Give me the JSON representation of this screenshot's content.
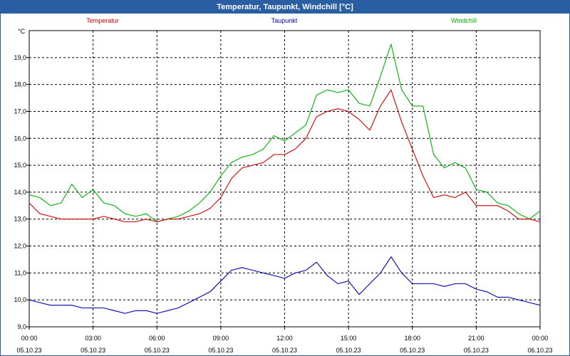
{
  "window": {
    "title": "Temperatur, Taupunkt, Windchill [°C]"
  },
  "chart_data": {
    "type": "line",
    "title": "Temperatur, Taupunkt, Windchill [°C]",
    "ylabel": "°C",
    "xlabel": "",
    "ylim": [
      9.0,
      20.0
    ],
    "y_ticks": [
      "9,0",
      "10,0",
      "11,0",
      "12,0",
      "13,0",
      "14,0",
      "15,0",
      "16,0",
      "17,0",
      "18,0",
      "19,0"
    ],
    "xlim": [
      0,
      24
    ],
    "x_ticks": [
      {
        "time": "00:00",
        "date": "05.10.23"
      },
      {
        "time": "03:00",
        "date": "05.10.23"
      },
      {
        "time": "06:00",
        "date": "05.10.23"
      },
      {
        "time": "09:00",
        "date": "05.10.23"
      },
      {
        "time": "12:00",
        "date": "05.10.23"
      },
      {
        "time": "15:00",
        "date": "05.10.23"
      },
      {
        "time": "18:00",
        "date": "05.10.23"
      },
      {
        "time": "21:00",
        "date": "05.10.23"
      },
      {
        "time": "00:00",
        "date": "06.10.23"
      }
    ],
    "grid": true,
    "legend": "top",
    "series": [
      {
        "name": "Temperatur",
        "color": "#d00000",
        "x": [
          0,
          0.5,
          1,
          1.5,
          2,
          2.5,
          3,
          3.5,
          4,
          4.5,
          5,
          5.5,
          6,
          6.5,
          7,
          7.5,
          8,
          8.5,
          9,
          9.5,
          10,
          10.5,
          11,
          11.5,
          12,
          12.5,
          13,
          13.5,
          14,
          14.5,
          15,
          15.5,
          16,
          16.5,
          17,
          17.5,
          18,
          18.5,
          19,
          19.5,
          20,
          20.5,
          21,
          21.5,
          22,
          22.5,
          23,
          23.5,
          24
        ],
        "values": [
          13.6,
          13.2,
          13.1,
          13.0,
          13.0,
          13.0,
          13.0,
          13.1,
          13.0,
          12.9,
          12.9,
          13.0,
          12.9,
          13.0,
          13.0,
          13.1,
          13.2,
          13.4,
          13.8,
          14.5,
          14.9,
          15.0,
          15.1,
          15.4,
          15.4,
          15.6,
          16.0,
          16.8,
          17.0,
          17.1,
          17.0,
          16.7,
          16.3,
          17.2,
          17.8,
          16.6,
          15.6,
          14.6,
          13.8,
          13.9,
          13.8,
          14.0,
          13.5,
          13.5,
          13.5,
          13.3,
          13.0,
          13.0,
          12.9
        ]
      },
      {
        "name": "Taupunkt",
        "color": "#0000b0",
        "x": [
          0,
          0.5,
          1,
          1.5,
          2,
          2.5,
          3,
          3.5,
          4,
          4.5,
          5,
          5.5,
          6,
          6.5,
          7,
          7.5,
          8,
          8.5,
          9,
          9.5,
          10,
          10.5,
          11,
          11.5,
          12,
          12.5,
          13,
          13.5,
          14,
          14.5,
          15,
          15.5,
          16,
          16.5,
          17,
          17.5,
          18,
          18.5,
          19,
          19.5,
          20,
          20.5,
          21,
          21.5,
          22,
          22.5,
          23,
          23.5,
          24
        ],
        "values": [
          10.0,
          9.9,
          9.8,
          9.8,
          9.8,
          9.7,
          9.7,
          9.7,
          9.6,
          9.5,
          9.6,
          9.6,
          9.5,
          9.6,
          9.7,
          9.9,
          10.1,
          10.3,
          10.7,
          11.1,
          11.2,
          11.1,
          11.0,
          10.9,
          10.8,
          11.0,
          11.1,
          11.4,
          10.9,
          10.6,
          10.7,
          10.2,
          10.6,
          11.0,
          11.6,
          11.0,
          10.6,
          10.6,
          10.6,
          10.5,
          10.6,
          10.6,
          10.4,
          10.3,
          10.1,
          10.1,
          10.0,
          9.9,
          9.8
        ]
      },
      {
        "name": "Windchill",
        "color": "#00b000",
        "x": [
          0,
          0.5,
          1,
          1.5,
          2,
          2.5,
          3,
          3.5,
          4,
          4.5,
          5,
          5.5,
          6,
          6.5,
          7,
          7.5,
          8,
          8.5,
          9,
          9.5,
          10,
          10.5,
          11,
          11.5,
          12,
          12.5,
          13,
          13.5,
          14,
          14.5,
          15,
          15.5,
          16,
          16.5,
          17,
          17.5,
          18,
          18.5,
          19,
          19.5,
          20,
          20.5,
          21,
          21.5,
          22,
          22.5,
          23,
          23.5,
          24
        ],
        "values": [
          13.9,
          13.8,
          13.5,
          13.6,
          14.3,
          13.8,
          14.1,
          13.6,
          13.5,
          13.2,
          13.1,
          13.2,
          12.9,
          13.0,
          13.1,
          13.3,
          13.6,
          14.0,
          14.6,
          15.1,
          15.3,
          15.4,
          15.6,
          16.1,
          15.9,
          16.2,
          16.5,
          17.6,
          17.8,
          17.7,
          17.8,
          17.3,
          17.2,
          18.3,
          19.5,
          17.8,
          17.2,
          17.2,
          15.4,
          14.9,
          15.1,
          14.9,
          14.1,
          14.0,
          13.6,
          13.5,
          13.2,
          13.0,
          13.3
        ]
      }
    ]
  }
}
